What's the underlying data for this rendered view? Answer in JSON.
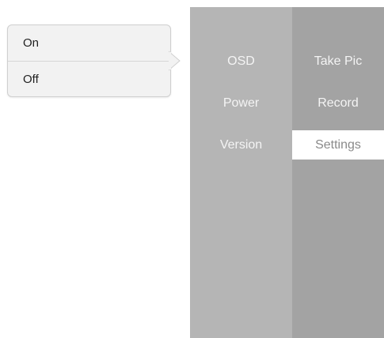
{
  "popover": {
    "options": [
      "On",
      "Off"
    ]
  },
  "menu": {
    "left_column": [
      "OSD",
      "Power",
      "Version"
    ],
    "right_column": [
      "Take Pic",
      "Record",
      "Settings"
    ],
    "selected": "Settings"
  },
  "colors": {
    "popover_bg": "#f2f2f2",
    "left_column_bg": "#b5b5b5",
    "right_column_bg": "#a3a3a3",
    "selected_bg": "#ffffff"
  }
}
